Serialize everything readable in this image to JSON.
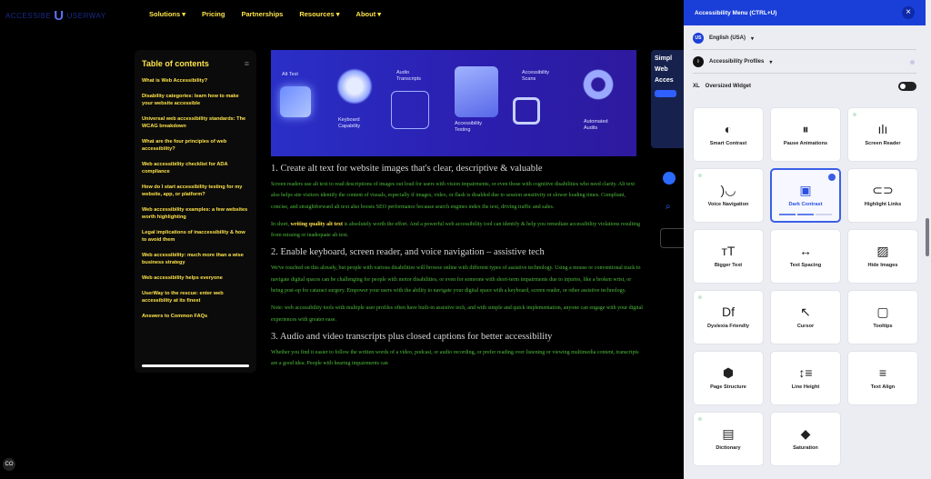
{
  "nav": {
    "logo_text_left": "ACCESSIBE",
    "logo_mark": "U",
    "logo_text_right": "USERWAY",
    "links": [
      "Solutions",
      "Pricing",
      "Partnerships",
      "Resources",
      "About"
    ]
  },
  "toc": {
    "title": "Table of contents",
    "menu_icon": "≡",
    "items": [
      "What is Web Accessibility?",
      "Disability categories: learn how to make your website accessible",
      "Universal web accessibility standards: The WCAG breakdown",
      "What are the four principles of web accessibility?",
      "Web accessibility checklist for ADA compliance",
      "How do I start accessibility testing for my website, app, or platform?",
      "Web accessibility examples: a few websites worth highlighting",
      "Legal implications of inaccessibility & how to avoid them",
      "Web accessibility: much more than a wise business strategy",
      "Web accessibility helps everyone",
      "UserWay to the rescue: enter web accessibility at its finest",
      "Answers to Common FAQs"
    ]
  },
  "hero": {
    "labels": {
      "alt_text": "Alt Text",
      "keyboard": "Keyboard\nCapability",
      "audio": "Audio\nTranscripts",
      "testing": "Accessibility\nTesting",
      "scans": "Accessibility\nScans",
      "audits": "Automated\nAudits"
    }
  },
  "side_card": {
    "text": "Simpl Web Acces"
  },
  "article": {
    "h1": "1. Create alt text for website images that's clear, descriptive & valuable",
    "p1": "Screen readers use alt text to read descriptions of images out loud for users with vision impairments, or even those with cognitive disabilities who need clarity. Alt text also helps site visitors identify the content of visuals, especially if images, video, or flash is disabled due to session sensitivity or slower loading times. Compliant, concise, and straightforward alt text also boosts SEO performance because search engines index the text, driving traffic and sales.",
    "p2_before": "In short, ",
    "p2_link": "writing quality alt text",
    "p2_after": " is absolutely worth the effort. And a powerful web accessibility tool can identify & help you remediate accessibility violations resulting from missing or inadequate alt text.",
    "h2": "2. Enable keyboard, screen reader, and voice navigation – assistive tech",
    "p3": "We've touched on this already, but people with various disabilities will browse online with different types of assistive technology. Using a mouse or conventional track to navigate digital spaces can be challenging for people with motor disabilities, or even for someone with short-term impairments due to injuries, like a broken wrist, or being post-op for cataract surgery. Empower your users with the ability to navigate your digital space with a keyboard, screen reader, or other assistive technology.",
    "p4": "Note: web accessibility tools with multiple user profiles often have built-in assistive tech, and with simple and quick implementation, anyone can engage with your digital experiences with greater ease.",
    "h3": "3. Audio and video transcripts plus closed captions for better accessibility",
    "p5": "Whether you find it easier to follow the written words of a video, podcast, or audio recording, or prefer reading over listening or viewing multimedia content, transcripts are a good idea. People with hearing impairments can"
  },
  "acc_panel": {
    "title": "Accessibility Menu (CTRL+U)",
    "close": "×",
    "language": "English (USA)",
    "language_badge": "US",
    "profiles": "Accessibility Profiles",
    "oversized": "Oversized Widget",
    "oversized_badge": "XL",
    "tiles": [
      {
        "label": "Smart Contrast",
        "icon": "◐",
        "dot": false
      },
      {
        "label": "Pause Animations",
        "icon": "⏸",
        "dot": false
      },
      {
        "label": "Screen Reader",
        "icon": "ılı",
        "dot": true
      },
      {
        "label": "Voice Navigation",
        "icon": ")◡",
        "dot": true
      },
      {
        "label": "Dark Contrast",
        "icon": "▣",
        "dot": false,
        "active": true
      },
      {
        "label": "Highlight Links",
        "icon": "⊂⊃",
        "dot": false
      },
      {
        "label": "Bigger Text",
        "icon": "тT",
        "dot": false
      },
      {
        "label": "Text Spacing",
        "icon": "↔",
        "dot": false
      },
      {
        "label": "Hide Images",
        "icon": "▨",
        "dot": false
      },
      {
        "label": "Dyslexia Friendly",
        "icon": "Df",
        "dot": true
      },
      {
        "label": "Cursor",
        "icon": "↖",
        "dot": false
      },
      {
        "label": "Tooltips",
        "icon": "▢",
        "dot": false
      },
      {
        "label": "Page Structure",
        "icon": "⬢",
        "dot": false
      },
      {
        "label": "Line Height",
        "icon": "↕≡",
        "dot": false
      },
      {
        "label": "Text Align",
        "icon": "≡",
        "dot": false
      },
      {
        "label": "Dictionary",
        "icon": "▤",
        "dot": true
      },
      {
        "label": "Saturation",
        "icon": "◆",
        "dot": false
      }
    ]
  },
  "corner": {
    "label": "CO"
  },
  "colors": {
    "accent": "#1a3fd8",
    "link": "#ffe44a",
    "body_text": "#4fbf3c"
  }
}
